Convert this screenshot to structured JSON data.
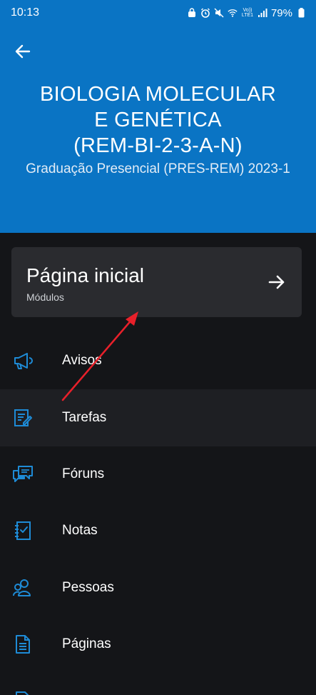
{
  "status": {
    "time": "10:13",
    "signal_label": "Vo)) LTE1",
    "battery": "79%"
  },
  "header": {
    "title_lines": [
      "BIOLOGIA MOLECULAR",
      "E GENÉTICA",
      "(REM-BI-2-3-A-N)"
    ],
    "subtitle": "Graduação Presencial (PRES-REM) 2023-1",
    "background": "#0a74c4"
  },
  "home": {
    "title": "Página inicial",
    "subtitle": "Módulos"
  },
  "menu": {
    "items": [
      {
        "label": "Avisos",
        "icon": "megaphone-icon"
      },
      {
        "label": "Tarefas",
        "icon": "assignment-icon"
      },
      {
        "label": "Fóruns",
        "icon": "forum-icon"
      },
      {
        "label": "Notas",
        "icon": "grades-icon"
      },
      {
        "label": "Pessoas",
        "icon": "people-icon"
      },
      {
        "label": "Páginas",
        "icon": "pages-icon"
      }
    ],
    "accent": "#1e8bd6"
  }
}
